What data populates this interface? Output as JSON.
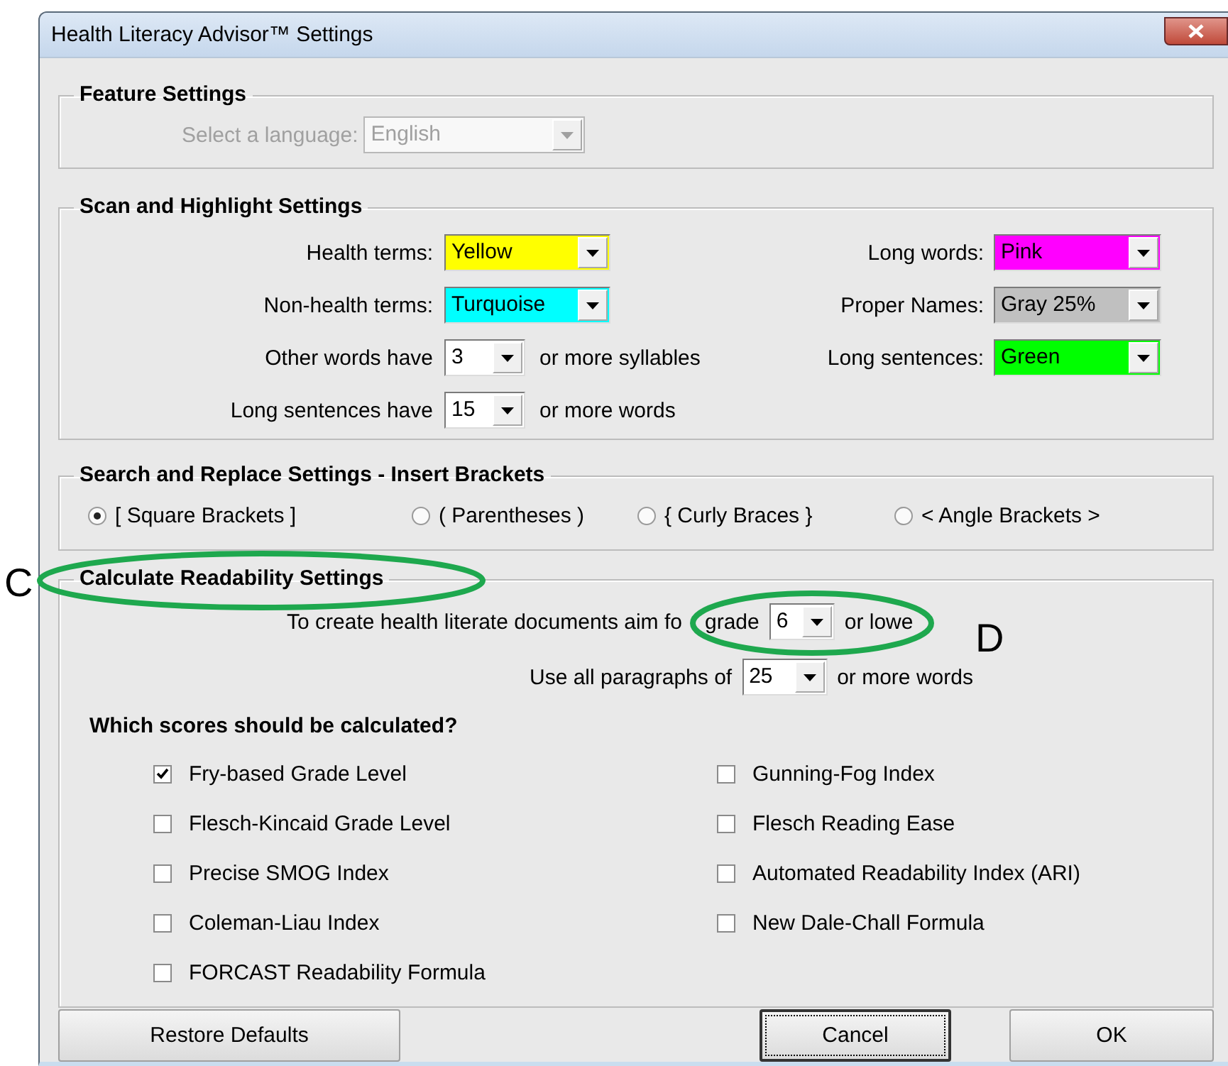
{
  "window": {
    "title": "Health Literacy Advisor™ Settings"
  },
  "feature_settings": {
    "title": "Feature Settings",
    "language": {
      "label": "Select a language:",
      "value": "English",
      "disabled": true
    }
  },
  "scan_settings": {
    "title": "Scan and Highlight Settings",
    "left": [
      {
        "kind": "color",
        "label": "Health terms:",
        "value": "Yellow",
        "color": "#ffff00"
      },
      {
        "kind": "color",
        "label": "Non-health terms:",
        "value": "Turquoise",
        "color": "#00ffff"
      },
      {
        "kind": "number",
        "label": "Other words have",
        "value": "3",
        "suffix": "or more syllables"
      },
      {
        "kind": "number",
        "label": "Long sentences have",
        "value": "15",
        "suffix": "or more words"
      }
    ],
    "right": [
      {
        "kind": "color",
        "label": "Long words:",
        "value": "Pink",
        "color": "#ff00ff"
      },
      {
        "kind": "color",
        "label": "Proper Names:",
        "value": "Gray 25%",
        "color": "#c0c0c0"
      },
      {
        "kind": "color",
        "label": "Long sentences:",
        "value": "Green",
        "color": "#00ff00"
      }
    ]
  },
  "search_settings": {
    "title": "Search and Replace Settings - Insert Brackets",
    "options": [
      {
        "label": "[ Square Brackets ]",
        "selected": true
      },
      {
        "label": "( Parentheses )",
        "selected": false
      },
      {
        "label": "{ Curly Braces }",
        "selected": false
      },
      {
        "label": "< Angle Brackets >",
        "selected": false
      }
    ]
  },
  "readability_settings": {
    "title": "Calculate Readability Settings",
    "rows": [
      {
        "label": "To create health literate documents aim fo",
        "label_2": "grade",
        "value": "6",
        "suffix": "or lowe"
      },
      {
        "label": "Use all paragraphs of",
        "value": "25",
        "suffix": "or more words"
      }
    ],
    "question": "Which scores should be calculated?",
    "scores_left": [
      {
        "label": "Fry-based Grade Level",
        "checked": true
      },
      {
        "label": "Flesch-Kincaid Grade Level",
        "checked": false
      },
      {
        "label": "Precise SMOG Index",
        "checked": false
      },
      {
        "label": "Coleman-Liau Index",
        "checked": false
      },
      {
        "label": "FORCAST Readability Formula",
        "checked": false
      }
    ],
    "scores_right": [
      {
        "label": "Gunning-Fog Index",
        "checked": false
      },
      {
        "label": "Flesch Reading Ease",
        "checked": false
      },
      {
        "label": "Automated Readability Index (ARI)",
        "checked": false
      },
      {
        "label": "New Dale-Chall Formula",
        "checked": false
      }
    ]
  },
  "buttons": [
    {
      "label": "Restore Defaults",
      "kind": "restore",
      "focused": false
    },
    {
      "label": "Cancel",
      "kind": "cancel",
      "focused": true
    },
    {
      "label": "OK",
      "kind": "ok",
      "focused": false
    }
  ],
  "annotations": [
    {
      "label": "C"
    },
    {
      "label": "D"
    }
  ]
}
